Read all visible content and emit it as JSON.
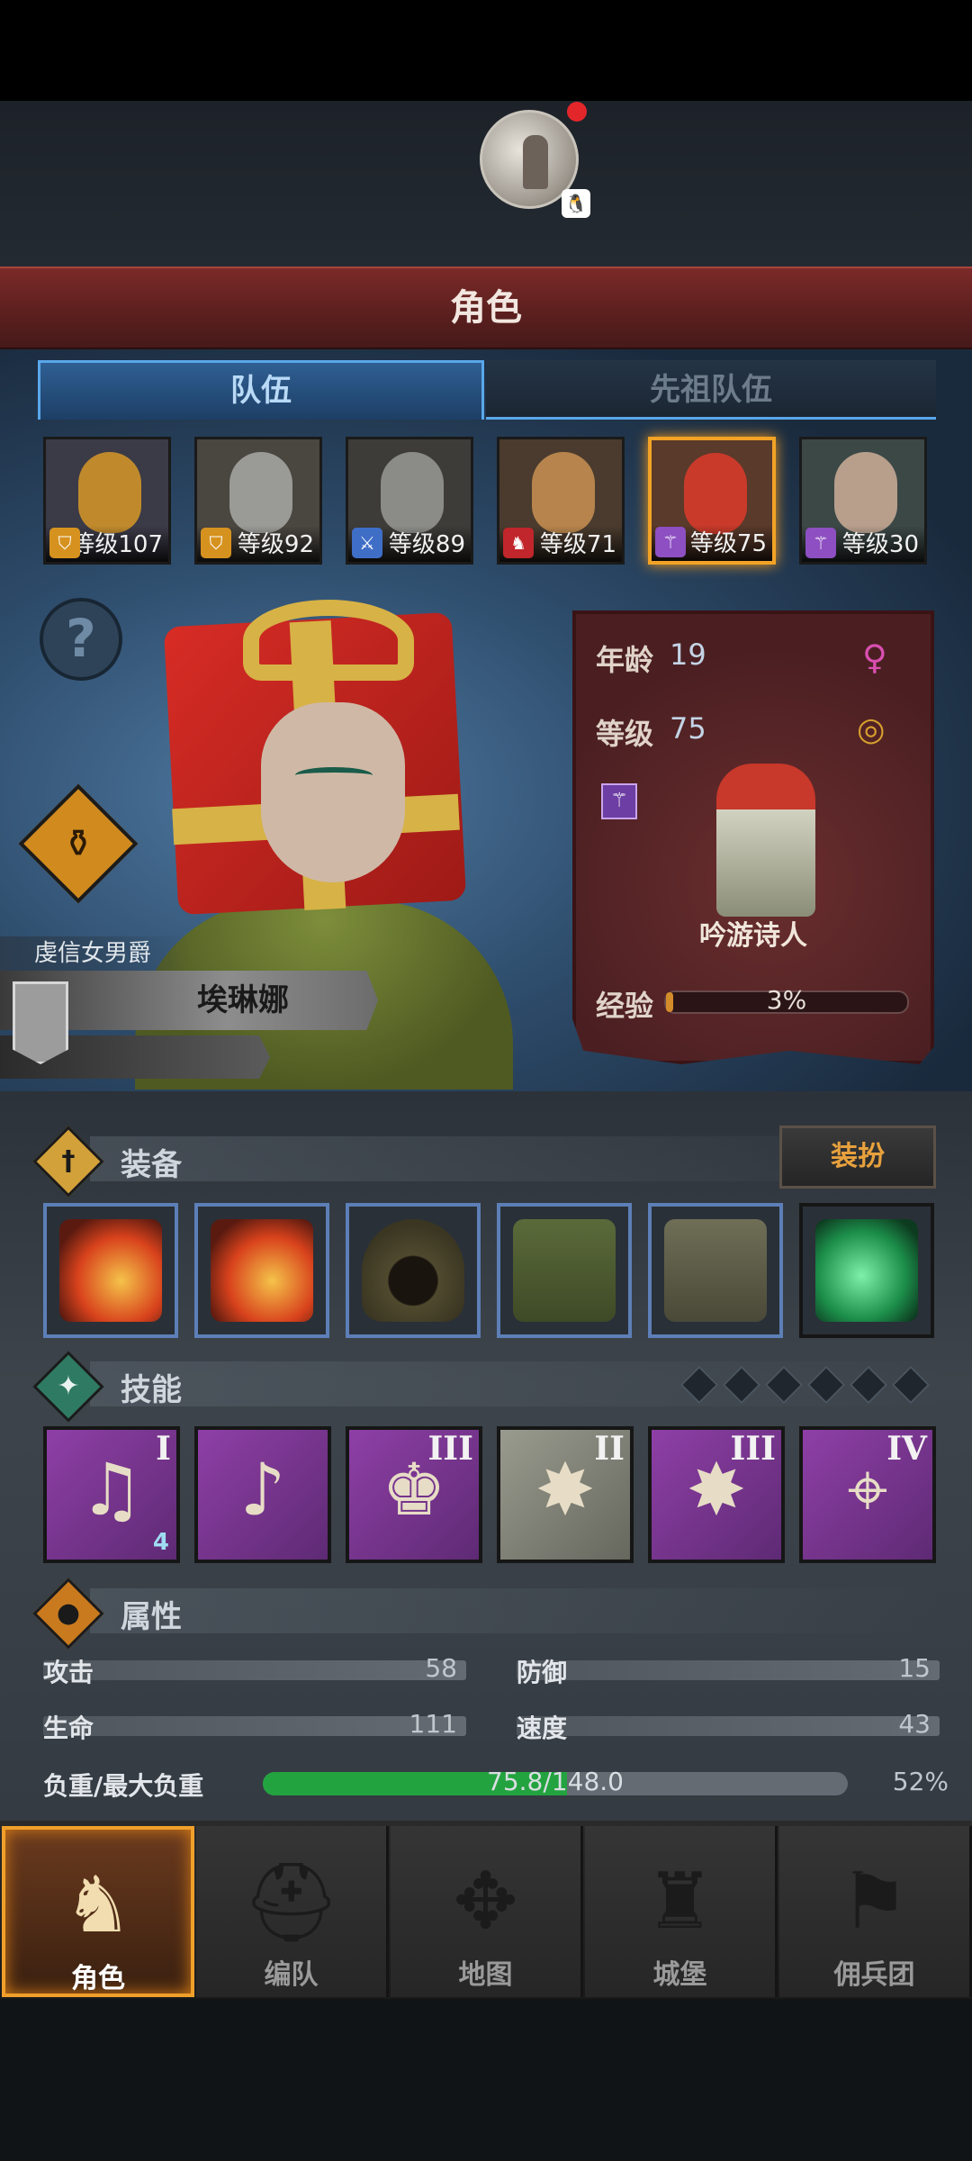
{
  "header": {
    "title": "角色",
    "qq_badge": "🐧"
  },
  "tabs": {
    "team": "队伍",
    "ancestor_team": "先祖队伍"
  },
  "roster": [
    {
      "level_text": "等级107",
      "class_icon": "shield-icon",
      "face_color": "#c08a2c",
      "bg": "#3b3a47",
      "badge_color": "#d6921f"
    },
    {
      "level_text": "等级92",
      "class_icon": "shield-icon",
      "face_color": "#9a9a96",
      "bg": "#4a4640",
      "badge_color": "#d6921f"
    },
    {
      "level_text": "等级89",
      "class_icon": "sword-icon",
      "face_color": "#8b8b88",
      "bg": "#3e3c38",
      "badge_color": "#3f6ec7"
    },
    {
      "level_text": "等级71",
      "class_icon": "wolf-icon",
      "face_color": "#b7844d",
      "bg": "#4a3b2e",
      "badge_color": "#c0262b"
    },
    {
      "level_text": "等级75",
      "class_icon": "staff-icon",
      "face_color": "#c93a2a",
      "bg": "#5a3a2a",
      "badge_color": "#8d4fc2",
      "selected": true
    },
    {
      "level_text": "等级30",
      "class_icon": "staff-icon",
      "face_color": "#b79f8c",
      "bg": "#3c4846",
      "badge_color": "#8d4fc2"
    }
  ],
  "hero": {
    "title": "虔信女男爵",
    "name": "埃琳娜"
  },
  "info": {
    "age_label": "年龄",
    "age": "19",
    "level_label": "等级",
    "level": "75",
    "class_name": "吟游诗人",
    "exp_label": "经验",
    "exp_text": "3%",
    "exp_fraction": 0.03,
    "gender_icon": "female-icon",
    "ring_icon": "ring-icon",
    "class_icon": "staff-icon"
  },
  "equipment": {
    "title": "装备",
    "dress_button": "装扮",
    "items": [
      {
        "name": "flame-weapon",
        "icon": "flame-weapon-icon"
      },
      {
        "name": "flame-weapon",
        "icon": "flame-weapon-icon"
      },
      {
        "name": "hood",
        "icon": "hood-icon"
      },
      {
        "name": "tunic",
        "icon": "tunic-icon"
      },
      {
        "name": "boots",
        "icon": "boots-icon"
      },
      {
        "name": "green-gem",
        "icon": "gem-icon"
      }
    ]
  },
  "skills": {
    "title": "技能",
    "slots_empty": 6,
    "items": [
      {
        "rank": "I",
        "icon": "music-debuff-icon",
        "extra": "4"
      },
      {
        "rank": "",
        "icon": "music-crystal-icon"
      },
      {
        "rank": "III",
        "icon": "group-heal-icon"
      },
      {
        "rank": "II",
        "icon": "burst-icon"
      },
      {
        "rank": "III",
        "icon": "burst-icon"
      },
      {
        "rank": "IV",
        "icon": "target-icon"
      }
    ]
  },
  "attributes": {
    "title": "属性",
    "attack_label": "攻击",
    "attack": "58",
    "defense_label": "防御",
    "defense": "15",
    "hp_label": "生命",
    "hp": "111",
    "speed_label": "速度",
    "speed": "43",
    "load_label": "负重/最大负重",
    "load_text": "75.8/148.0",
    "load_percent": "52%",
    "load_fraction": 0.52
  },
  "nav": [
    {
      "label": "角色",
      "icon": "knight-icon",
      "active": true
    },
    {
      "label": "编队",
      "icon": "helmet-icon"
    },
    {
      "label": "地图",
      "icon": "compass-icon"
    },
    {
      "label": "城堡",
      "icon": "castle-icon"
    },
    {
      "label": "佣兵团",
      "icon": "banner-icon"
    }
  ]
}
